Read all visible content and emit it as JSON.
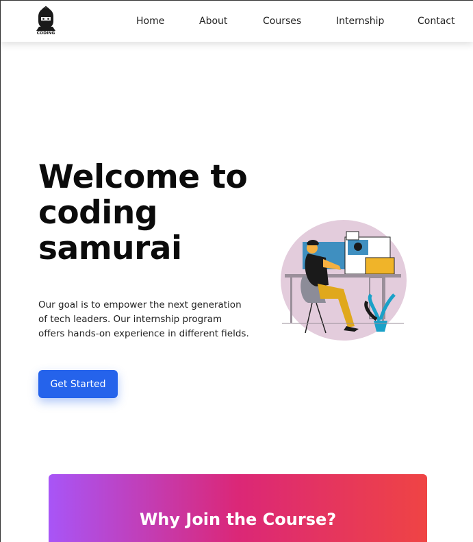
{
  "nav": {
    "logo_text": "CODING",
    "links": [
      {
        "label": "Home"
      },
      {
        "label": "About"
      },
      {
        "label": "Courses"
      },
      {
        "label": "Internship"
      },
      {
        "label": "Contact"
      }
    ]
  },
  "hero": {
    "title": "Welcome to coding samurai",
    "description": "Our goal is to empower the next generation of tech leaders. Our internship program offers hands-on experience in different fields.",
    "cta_label": "Get Started"
  },
  "why_section": {
    "title": "Why Join the Course?"
  },
  "colors": {
    "primary": "#2563eb",
    "gradient_start": "#a855f7",
    "gradient_mid": "#db2777",
    "gradient_end": "#ef4444"
  }
}
